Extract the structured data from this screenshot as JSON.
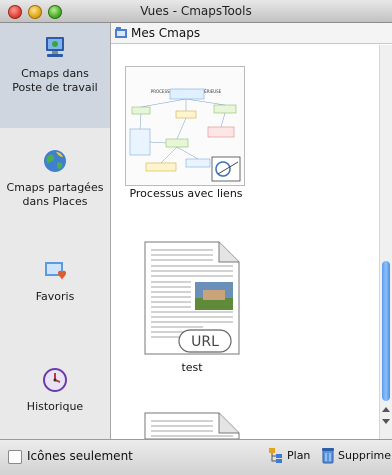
{
  "window": {
    "title": "Vues - CmapsTools"
  },
  "sidebar": {
    "items": [
      {
        "label_line1": "Cmaps dans",
        "label_line2": "Poste de travail",
        "icon": "computer-icon",
        "selected": true
      },
      {
        "label_line1": "Cmaps partagées",
        "label_line2": "dans Places",
        "icon": "globe-icon",
        "selected": false
      },
      {
        "label_line1": "Favoris",
        "icon": "favorites-icon",
        "selected": false
      },
      {
        "label_line1": "Historique",
        "icon": "history-icon",
        "selected": false
      }
    ]
  },
  "pathbar": {
    "label": "Mes Cmaps",
    "icon": "folder-home-icon"
  },
  "items": [
    {
      "name": "Processus avec liens",
      "type": "cmap"
    },
    {
      "name": "test",
      "type": "url",
      "badge": "URL"
    }
  ],
  "thumbnail": {
    "title_text": "PROCESSUS D'ÉCRITURE SÉRIEUSE"
  },
  "bottom": {
    "checkbox_label": "Icônes seulement",
    "plan_label": "Plan",
    "delete_label": "Supprimer"
  },
  "colors": {
    "selection": "#cfd6df",
    "scroll_thumb": "#6aa6f0"
  }
}
